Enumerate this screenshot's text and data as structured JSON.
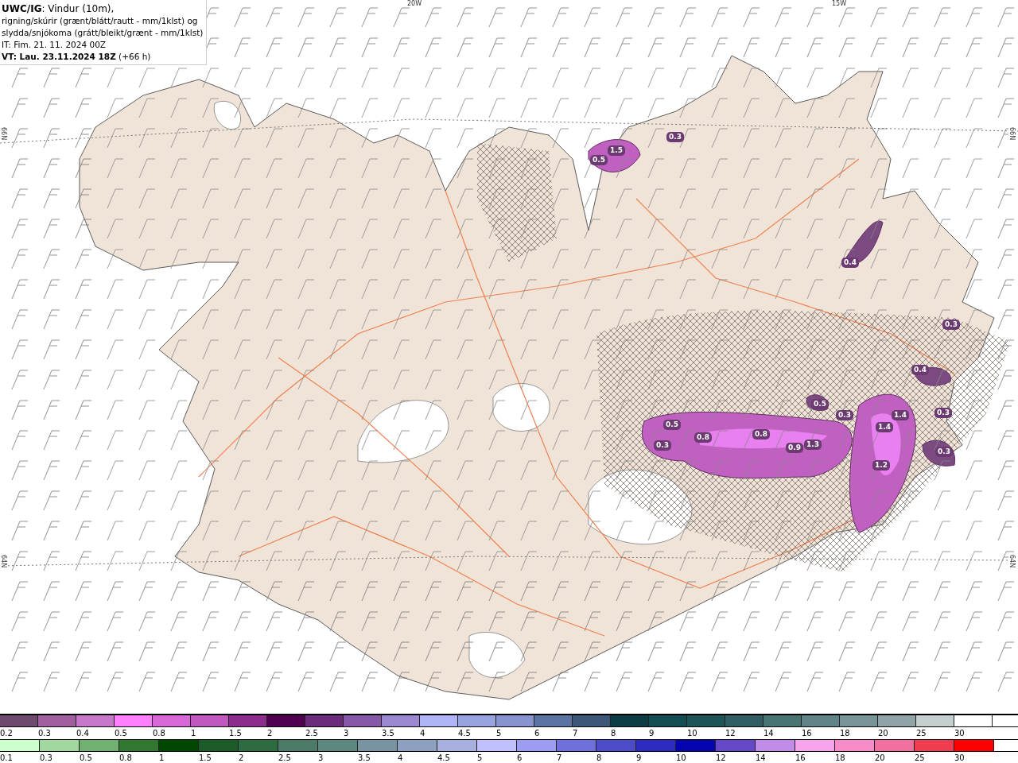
{
  "header": {
    "lines": [
      "**UWC/IG**: Vindur (10m),",
      "rigning/skúrir (grænt/blátt/rautt - mm/1klst) og",
      "slydda/snjókoma (grátt/bleikt/grænt - mm/1klst)",
      "IT: Fim. 21. 11. 2024 00Z",
      "**VT: Lau. 23.11.2024 18Z** (+66 h)"
    ]
  },
  "map": {
    "grid_labels": [
      {
        "text": "20W",
        "kind": "lon"
      },
      {
        "text": "15W",
        "kind": "lon"
      },
      {
        "text": "66N",
        "kind": "lat-left"
      },
      {
        "text": "66N",
        "kind": "lat-right"
      },
      {
        "text": "64N",
        "kind": "lat-left"
      },
      {
        "text": "64N",
        "kind": "lat-right"
      }
    ],
    "values": [
      "1.5",
      "0.5",
      "0.3",
      "0.4",
      "0.4",
      "0.5",
      "0.3",
      "1.4",
      "0.3",
      "0.5",
      "0.8",
      "0.8",
      "0.9",
      "1.3",
      "1.4",
      "0.3",
      "0.3",
      "1.2",
      "0.3"
    ]
  },
  "legend": {
    "upper": [
      {
        "label": "0.2",
        "color": "#6e4a6e"
      },
      {
        "label": "0.3",
        "color": "#a060a0"
      },
      {
        "label": "0.4",
        "color": "#c878c8"
      },
      {
        "label": "0.5",
        "color": "#ff80ff"
      },
      {
        "label": "0.8",
        "color": "#d868d8"
      },
      {
        "label": "1",
        "color": "#c058c0"
      },
      {
        "label": "1.5",
        "color": "#8c2c8c"
      },
      {
        "label": "2",
        "color": "#500050"
      },
      {
        "label": "2.5",
        "color": "#6c2c7c"
      },
      {
        "label": "3",
        "color": "#8858a8"
      },
      {
        "label": "3.5",
        "color": "#9c88d0"
      },
      {
        "label": "4",
        "color": "#b0b4f8"
      },
      {
        "label": "4.5",
        "color": "#98a4e0"
      },
      {
        "label": "5",
        "color": "#8894d0"
      },
      {
        "label": "6",
        "color": "#5c74a4"
      },
      {
        "label": "7",
        "color": "#3c5878"
      },
      {
        "label": "8",
        "color": "#0c3c44"
      },
      {
        "label": "9",
        "color": "#144c54"
      },
      {
        "label": "10",
        "color": "#1c5458"
      },
      {
        "label": "12",
        "color": "#305c64"
      },
      {
        "label": "14",
        "color": "#487474"
      },
      {
        "label": "16",
        "color": "#608488"
      },
      {
        "label": "18",
        "color": "#789498"
      },
      {
        "label": "20",
        "color": "#90a4a8"
      },
      {
        "label": "25",
        "color": "#c4d0d0"
      },
      {
        "label": "30",
        "color": "#ffffff"
      }
    ],
    "lower": [
      {
        "label": "0.1",
        "color": "#ccffcc"
      },
      {
        "label": "0.3",
        "color": "#a0d8a0"
      },
      {
        "label": "0.5",
        "color": "#70b070"
      },
      {
        "label": "0.8",
        "color": "#307830"
      },
      {
        "label": "1",
        "color": "#004800"
      },
      {
        "label": "1.5",
        "color": "#1c5c28"
      },
      {
        "label": "2",
        "color": "#2c6c40"
      },
      {
        "label": "2.5",
        "color": "#4c7c68"
      },
      {
        "label": "3",
        "color": "#5c8880"
      },
      {
        "label": "3.5",
        "color": "#7894a0"
      },
      {
        "label": "4",
        "color": "#8ca0c0"
      },
      {
        "label": "4.5",
        "color": "#a8b0e0"
      },
      {
        "label": "5",
        "color": "#c0c0ff"
      },
      {
        "label": "6",
        "color": "#9c9cf0"
      },
      {
        "label": "7",
        "color": "#7070dc"
      },
      {
        "label": "8",
        "color": "#4c4cc8"
      },
      {
        "label": "9",
        "color": "#2c2cc0"
      },
      {
        "label": "10",
        "color": "#0404b0"
      },
      {
        "label": "12",
        "color": "#6448c8"
      },
      {
        "label": "14",
        "color": "#c08ce8"
      },
      {
        "label": "16",
        "color": "#f8a4ec"
      },
      {
        "label": "18",
        "color": "#f88cc8"
      },
      {
        "label": "20",
        "color": "#f070a0"
      },
      {
        "label": "25",
        "color": "#f03c50"
      },
      {
        "label": "30",
        "color": "#ff0000"
      }
    ]
  }
}
